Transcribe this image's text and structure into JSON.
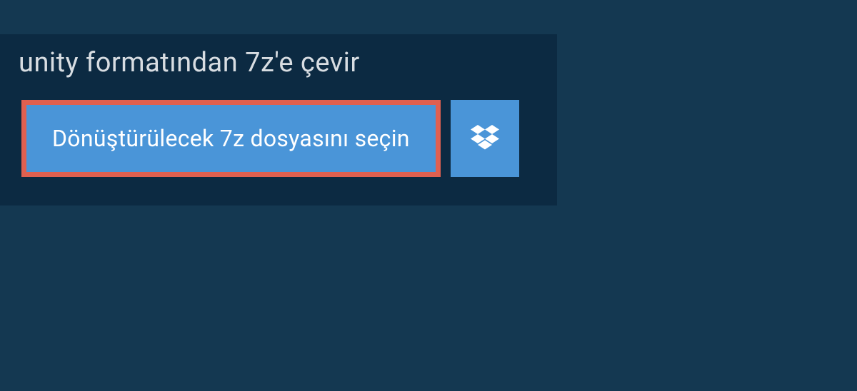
{
  "header": {
    "title": "unity formatından 7z'e çevir"
  },
  "actions": {
    "select_file_label": "Dönüştürülecek 7z dosyasını seçin",
    "dropbox_icon": "dropbox-icon"
  },
  "colors": {
    "page_bg": "#143851",
    "panel_bg": "#0c2a42",
    "button_bg": "#4a95d8",
    "button_border": "#e06050",
    "text_light": "#d8dde2",
    "text_white": "#ffffff"
  }
}
